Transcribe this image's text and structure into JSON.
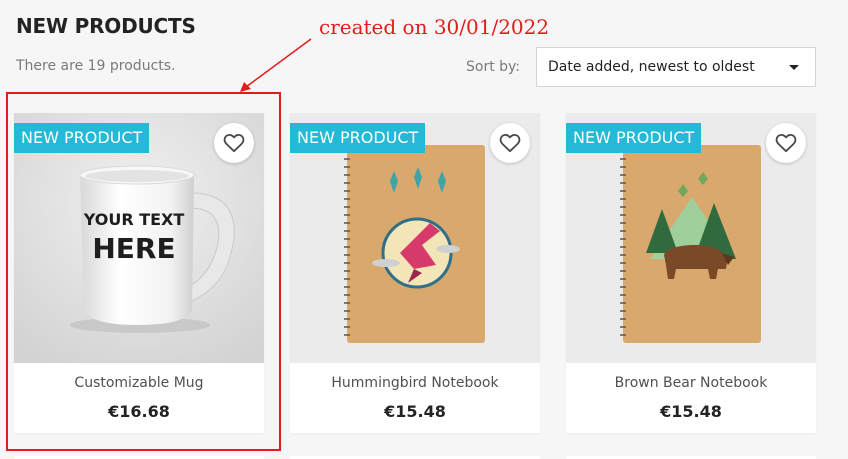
{
  "header": {
    "title": "NEW PRODUCTS",
    "count_text": "There are 19 products.",
    "sort_label": "Sort by:",
    "sort_value": "Date added, newest to oldest"
  },
  "annotation": {
    "text": "created on 30/01/2022",
    "color": "#e31b1b"
  },
  "products": [
    {
      "badge": "NEW PRODUCT",
      "name": "Customizable Mug",
      "price": "€16.68",
      "mug_text_1": "YOUR TEXT",
      "mug_text_2": "HERE"
    },
    {
      "badge": "NEW PRODUCT",
      "name": "Hummingbird Notebook",
      "price": "€15.48"
    },
    {
      "badge": "NEW PRODUCT",
      "name": "Brown Bear Notebook",
      "price": "€15.48"
    }
  ],
  "colors": {
    "badge": "#24b9d7",
    "notebook_cover": "#d9a86c",
    "highlight_border": "#e31b1b"
  },
  "icons": {
    "wishlist": "heart-outline-icon",
    "sort_dropdown": "caret-down-icon"
  }
}
